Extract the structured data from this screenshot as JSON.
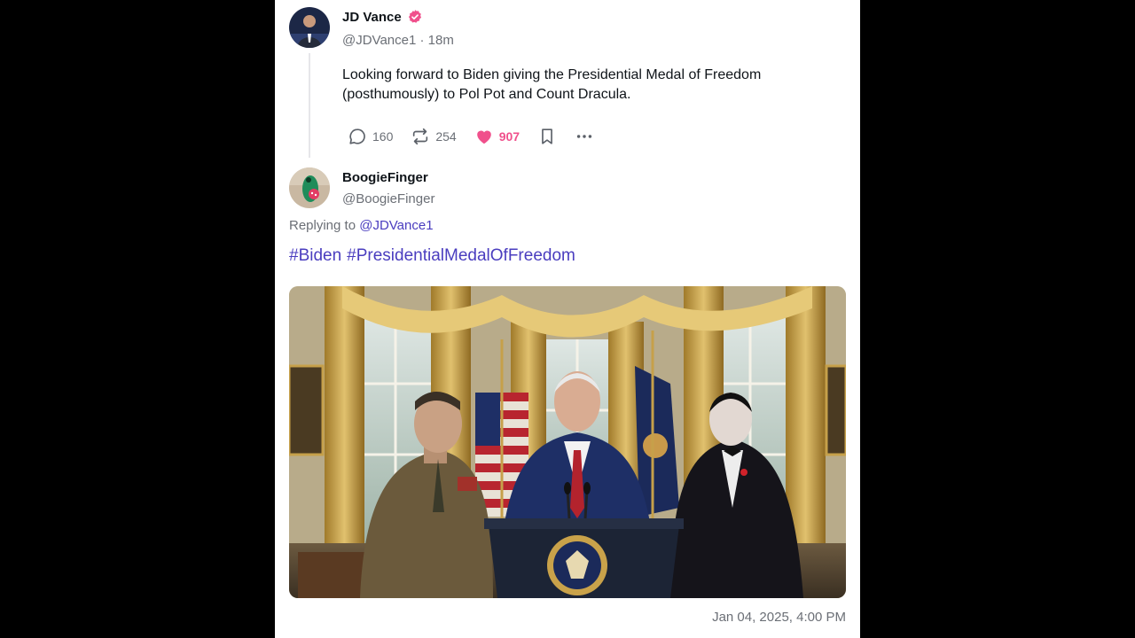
{
  "post": {
    "author_name": "JD Vance",
    "author_handle": "@JDVance1",
    "time_ago": "18m",
    "text": "Looking forward to Biden giving the Presidential Medal of Freedom (posthumously) to Pol Pot and Count Dracula.",
    "reply_count": "160",
    "repost_count": "254",
    "like_count": "907",
    "verified_icon": "verified-badge-icon",
    "accent_color": "#f0508c"
  },
  "reply": {
    "author_name": "BoogieFinger",
    "author_handle": "@BoogieFinger",
    "replying_prefix": "Replying to",
    "replying_to": "@JDVance1",
    "hashtags": [
      "#Biden",
      "#PresidentialMedalOfFreedom"
    ],
    "timestamp": "Jan 04, 2025, 4:00 PM",
    "link_color": "#4a3dbf"
  }
}
